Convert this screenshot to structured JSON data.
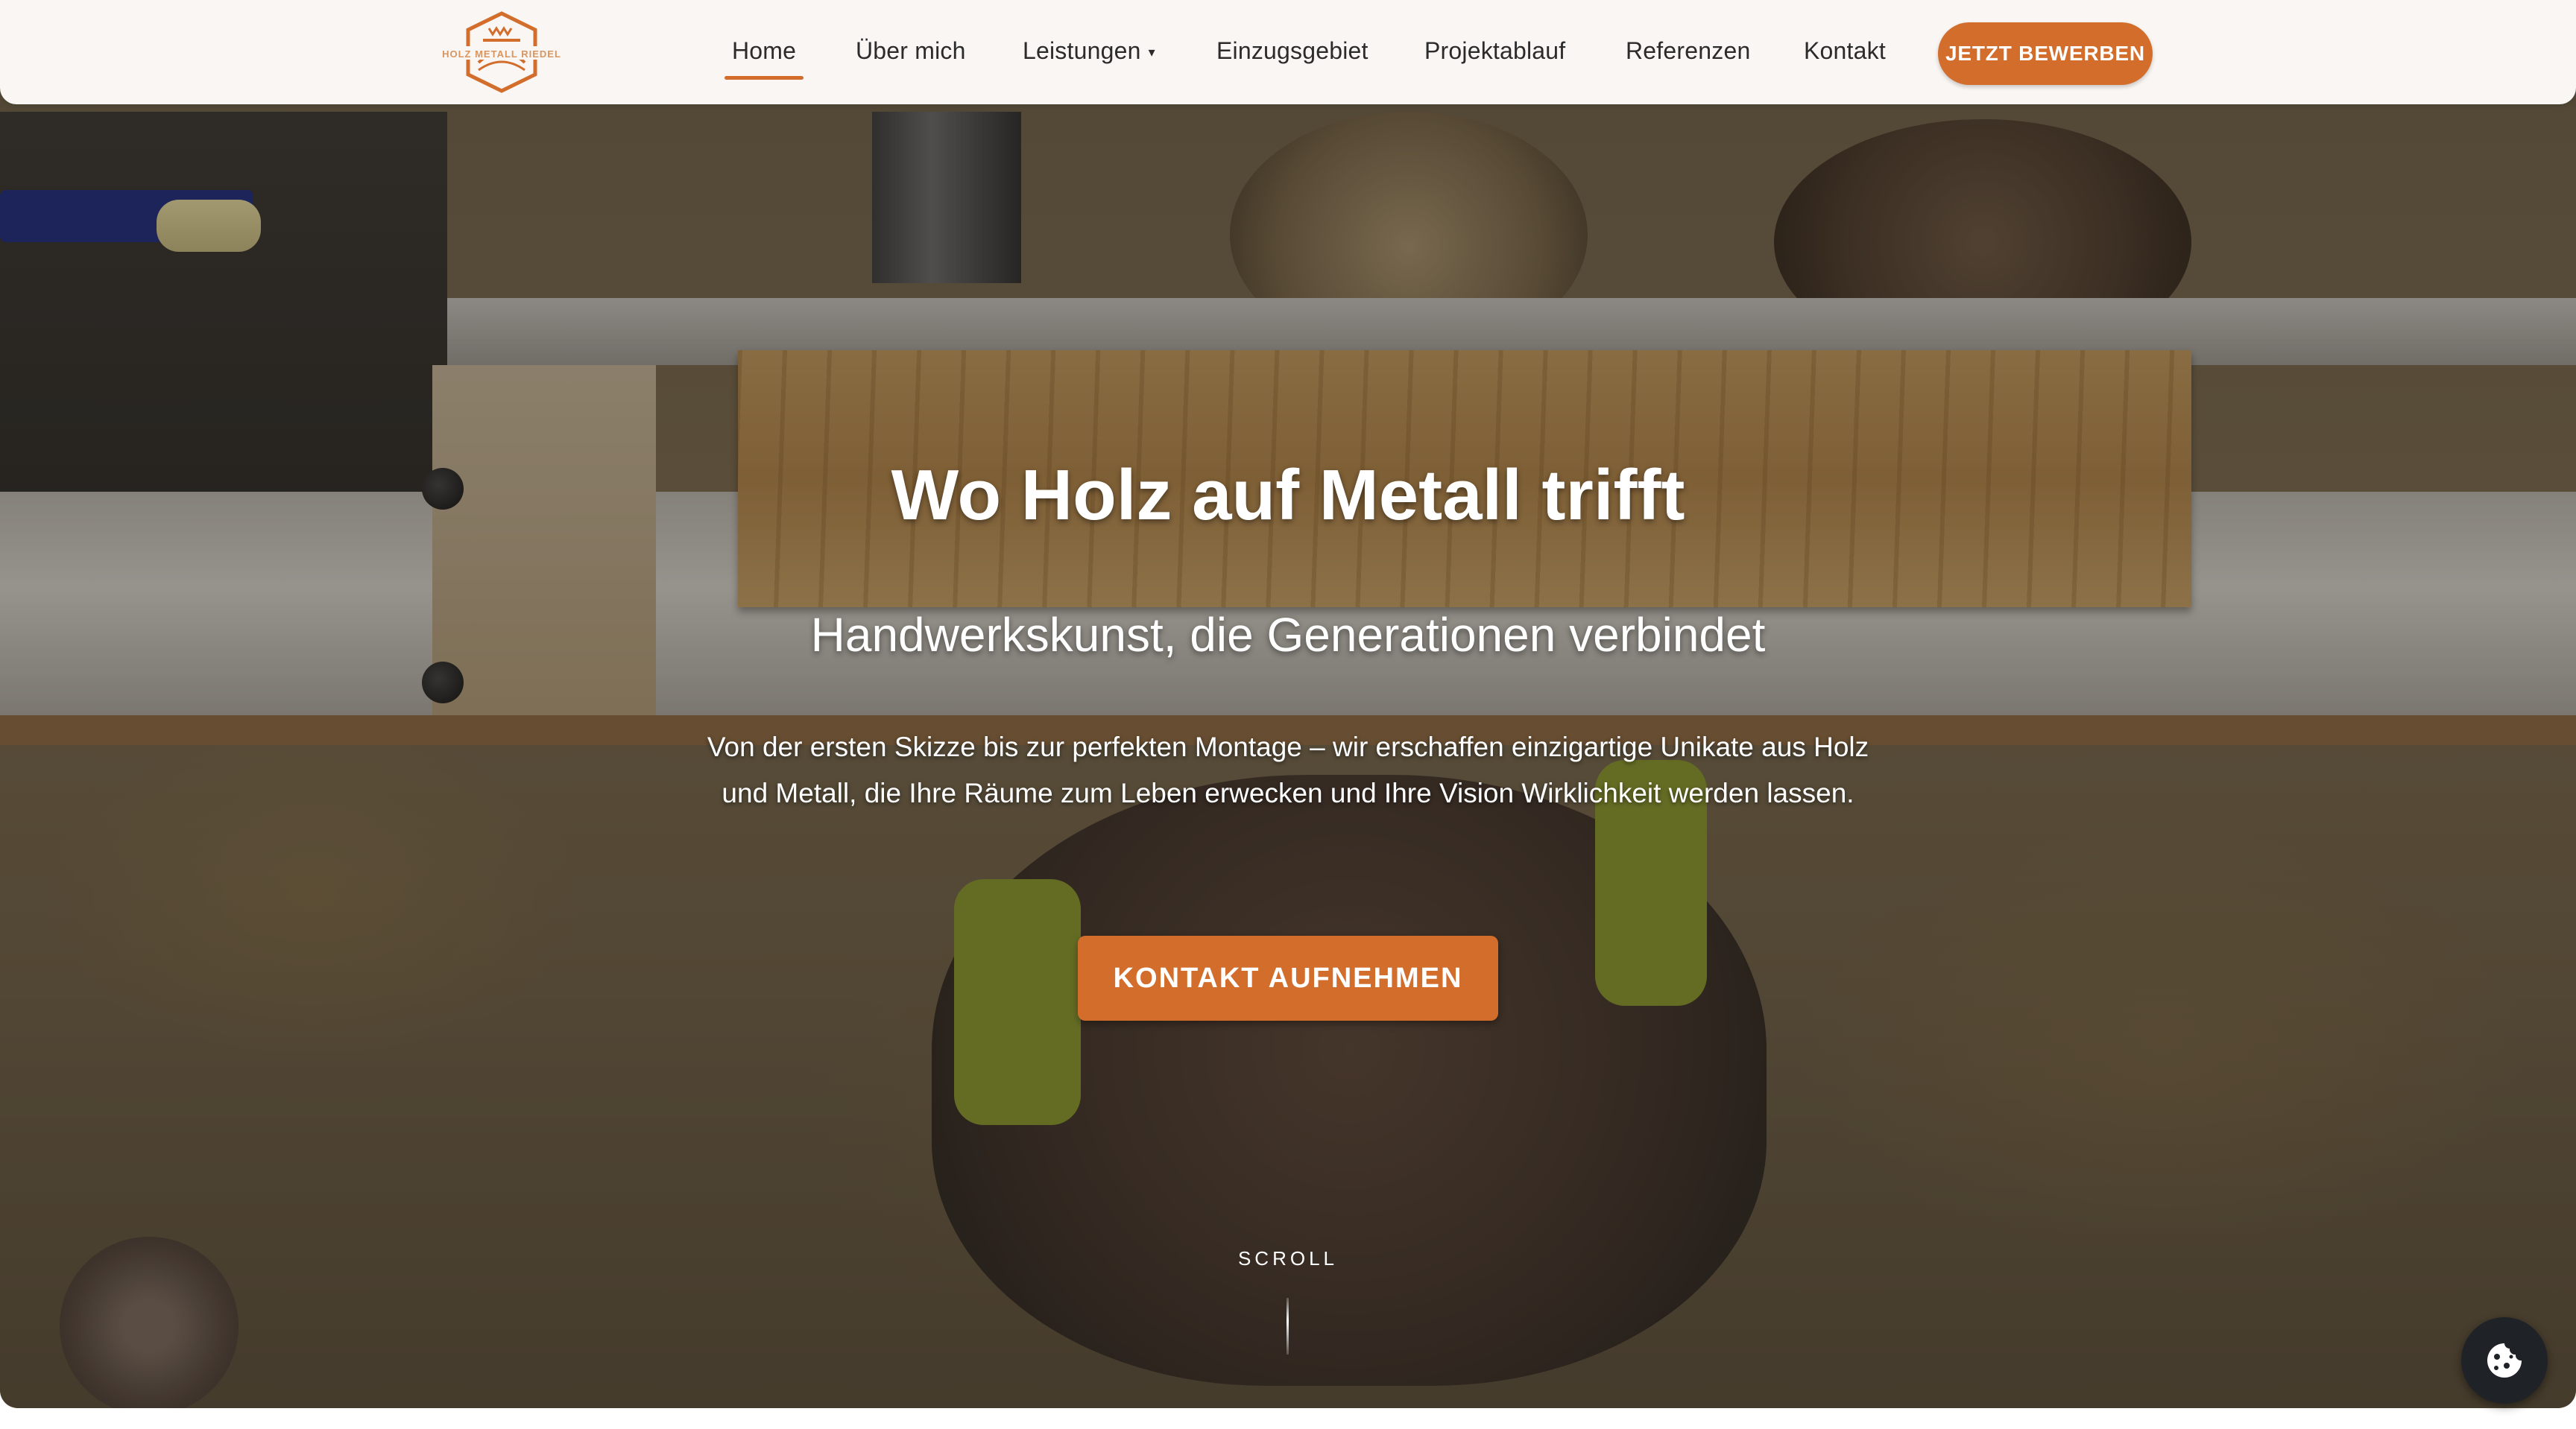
{
  "brand": {
    "logo_text": "HOLZ METALL RIEDEL",
    "accent_color": "#d26d2c"
  },
  "nav": {
    "items": [
      {
        "label": "Home",
        "active": true
      },
      {
        "label": "Über mich",
        "active": false
      },
      {
        "label": "Leistungen",
        "active": false,
        "has_dropdown": true
      },
      {
        "label": "Einzugsgebiet",
        "active": false
      },
      {
        "label": "Projektablauf",
        "active": false
      },
      {
        "label": "Referenzen",
        "active": false
      },
      {
        "label": "Kontakt",
        "active": false
      }
    ],
    "cta_label": "JETZT BEWERBEN",
    "dropdown_caret_icon": "caret-down-icon"
  },
  "hero": {
    "title": "Wo Holz auf Metall trifft",
    "subtitle": "Handwerkskunst, die Generationen verbindet",
    "description": "Von der ersten Skizze bis zur perfekten Montage – wir erschaffen einzigartige Unikate aus Holz und Metall, die Ihre Räume zum Leben erwecken und Ihre Vision Wirklichkeit werden lassen.",
    "cta_label": "KONTAKT AUFNEHMEN",
    "scroll_label": "SCROLL",
    "background": "workshop-video-still"
  },
  "cookie": {
    "icon": "cookie-icon"
  }
}
